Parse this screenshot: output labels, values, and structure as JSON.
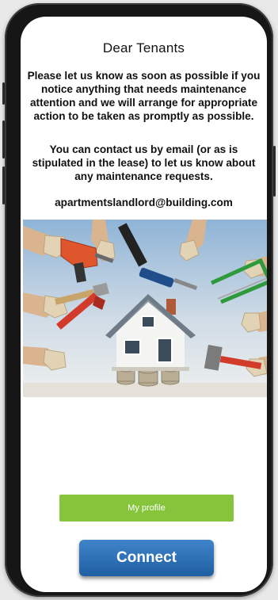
{
  "notice": {
    "title": "Dear Tenants",
    "paragraph1": "Please let us know as soon as possible if you notice anything that needs maintenance attention and we will arrange for appropriate action to be taken as promptly as possible.",
    "paragraph2": "You can contact us by email (or as is stipulated in the lease) to let us know about any maintenance requests.",
    "email": "apartmentslandlord@building.com"
  },
  "hero_image": {
    "icon": "house-repair-tools-illustration"
  },
  "buttons": {
    "profile_label": "My profile",
    "profile_color": "#86c43c",
    "connect_label": "Connect",
    "connect_color": "#2a6db5"
  }
}
